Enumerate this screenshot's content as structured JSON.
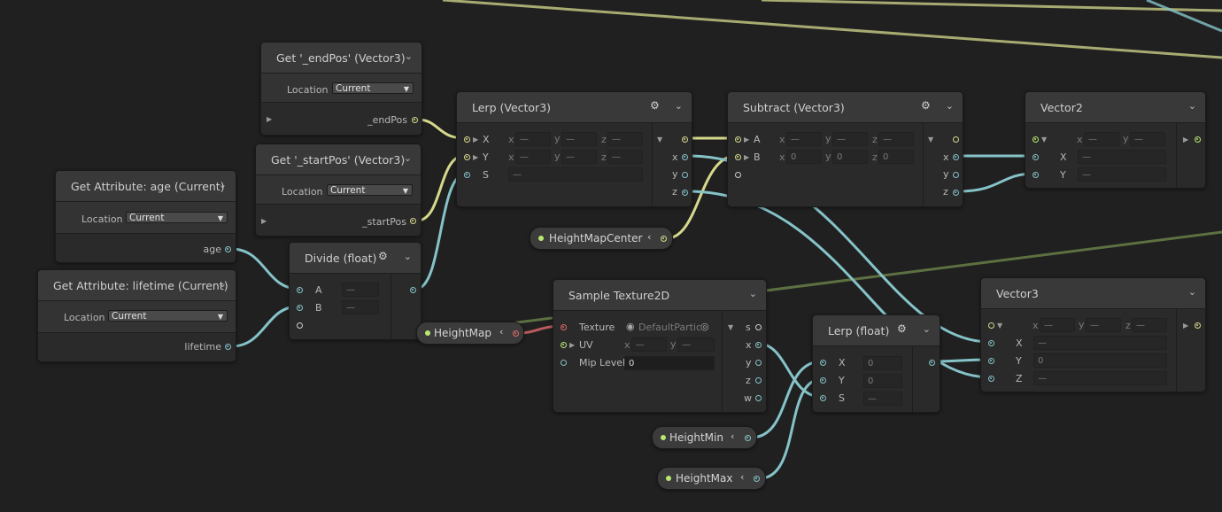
{
  "icons": {
    "gear": "gear-icon",
    "chevron": "chevron-down-icon",
    "collapse": "chevron-left-icon"
  },
  "colors": {
    "background": "#202020",
    "vector3_wire": "#d6d98c",
    "float_wire": "#85c3c9",
    "vector2_wire": "#b9e872",
    "texture_wire": "#e06a6a"
  },
  "get_endpos": {
    "title": "Get '_endPos' (Vector3)",
    "location_label": "Location",
    "location_value": "Current",
    "output": "_endPos"
  },
  "get_startpos": {
    "title": "Get '_startPos' (Vector3)",
    "location_label": "Location",
    "location_value": "Current",
    "output": "_startPos"
  },
  "get_age": {
    "title": "Get Attribute: age (Current)",
    "location_label": "Location",
    "location_value": "Current",
    "output": "age"
  },
  "get_lifetime": {
    "title": "Get Attribute: lifetime (Current)",
    "location_label": "Location",
    "location_value": "Current",
    "output": "lifetime"
  },
  "divide": {
    "title": "Divide (float)",
    "input_a": "A",
    "input_b": "B",
    "value_a": "—",
    "value_b": "—"
  },
  "lerp_vec3": {
    "title": "Lerp (Vector3)",
    "input_x": "X",
    "input_y": "Y",
    "input_s": "S",
    "cx": "x",
    "cy": "y",
    "cz": "z",
    "dash": "—",
    "out_x": "x",
    "out_y": "y",
    "out_z": "z"
  },
  "subtract": {
    "title": "Subtract (Vector3)",
    "input_a": "A",
    "input_b": "B",
    "cx": "x",
    "cy": "y",
    "cz": "z",
    "dash": "—",
    "b_x": "0",
    "b_y": "0",
    "b_z": "0",
    "out_x": "x",
    "out_y": "y",
    "out_z": "z"
  },
  "vector2": {
    "title": "Vector2",
    "cx": "x",
    "cy": "y",
    "dash": "—",
    "input_x": "X",
    "input_y": "Y"
  },
  "vector3": {
    "title": "Vector3",
    "cx": "x",
    "cy": "y",
    "cz": "z",
    "dash": "—",
    "input_x": "X",
    "input_y": "Y",
    "input_z": "Z",
    "value_y": "0"
  },
  "sample_texture": {
    "title": "Sample Texture2D",
    "texture_label": "Texture",
    "texture_value": "DefaultPartic",
    "uv_label": "UV",
    "cx": "x",
    "cy": "y",
    "dash": "—",
    "mip_label": "Mip Level",
    "mip_value": "0",
    "out_s": "s",
    "out_x": "x",
    "out_y": "y",
    "out_z": "z",
    "out_w": "w"
  },
  "lerp_float": {
    "title": "Lerp (float)",
    "input_x": "X",
    "input_y": "Y",
    "input_s": "S",
    "value_x": "0",
    "value_y": "0",
    "value_s": "—"
  },
  "pills": {
    "heightmapcenter": "HeightMapCenter",
    "heightmap": "HeightMap",
    "heightmin": "HeightMin",
    "heightmax": "HeightMax",
    "collapse_glyph": "‹"
  }
}
